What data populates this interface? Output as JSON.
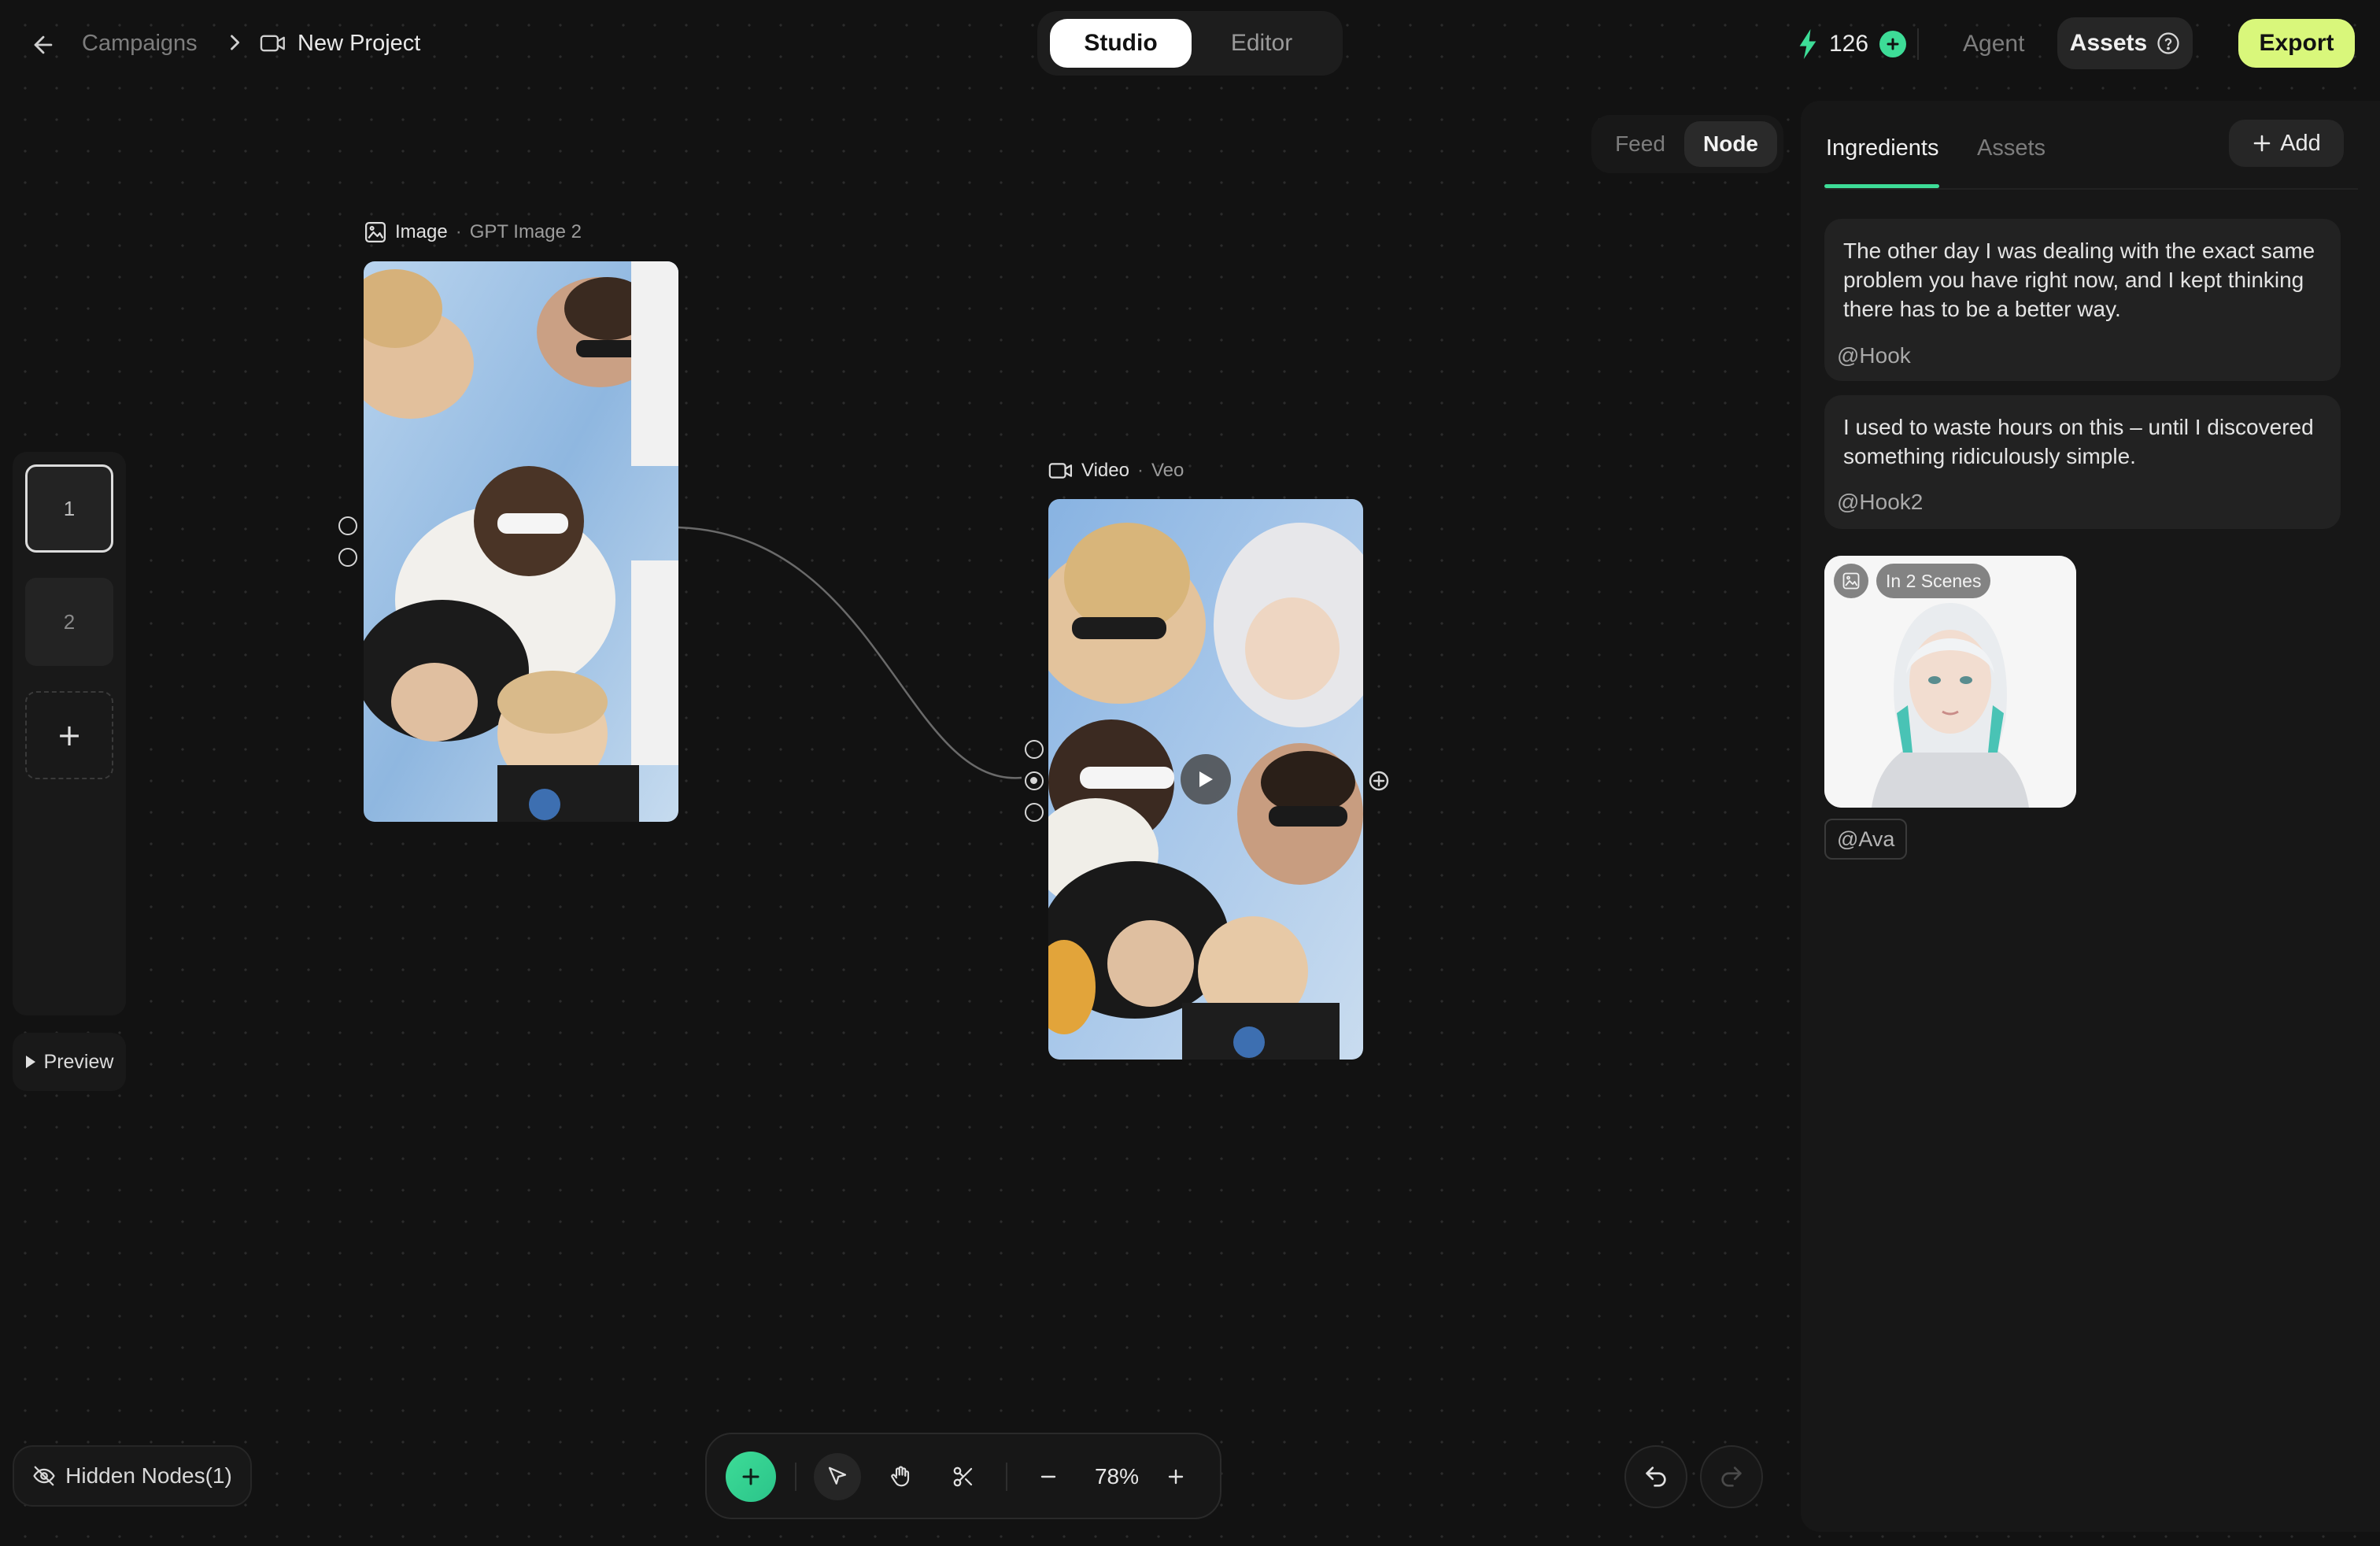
{
  "header": {
    "breadcrumb_parent": "Campaigns",
    "project_title": "New Project"
  },
  "mode_switch": {
    "studio": "Studio",
    "editor": "Editor",
    "selected": "Studio"
  },
  "credits": {
    "count": "126"
  },
  "top_actions": {
    "agent": "Agent",
    "assets": "Assets",
    "export": "Export"
  },
  "view_toggle": {
    "feed": "Feed",
    "node": "Node",
    "selected": "Node"
  },
  "scenes": {
    "items": [
      "1",
      "2"
    ],
    "selected": "1",
    "add_symbol": "+",
    "preview": "Preview"
  },
  "nodes": {
    "image": {
      "type": "Image",
      "separator": "·",
      "model": "GPT Image 2"
    },
    "video": {
      "type": "Video",
      "separator": "·",
      "model": "Veo"
    }
  },
  "panel": {
    "tabs": [
      "Ingredients",
      "Assets"
    ],
    "active_tab": "Ingredients",
    "add_label": "Add",
    "ingredients": [
      {
        "text": "The other day I was dealing with the exact same problem you have right now, and I kept thinking there has to be a better way.",
        "tag": "@Hook"
      },
      {
        "text": "I used to waste hours on this – until I discovered something ridiculously simple.",
        "tag": "@Hook2"
      }
    ],
    "character": {
      "badge": "In 2 Scenes",
      "tag": "@Ava"
    }
  },
  "bottom": {
    "hidden_nodes": "Hidden Nodes(1)",
    "zoom": "78%"
  },
  "colors": {
    "background": "#121212",
    "accent_green": "#3ddc97",
    "export_button": "#d9f77b",
    "credits_bolt": "#3ddc97"
  },
  "icons": [
    "arrow-left-icon",
    "chevron-right-icon",
    "video-camera-icon",
    "lightning-bolt-icon",
    "plus-circle-icon",
    "help-circle-icon",
    "image-icon",
    "play-icon",
    "plus-icon",
    "eye-off-icon",
    "cursor-icon",
    "hand-icon",
    "scissors-icon",
    "minus-icon",
    "undo-icon",
    "redo-icon",
    "add-port-icon"
  ]
}
